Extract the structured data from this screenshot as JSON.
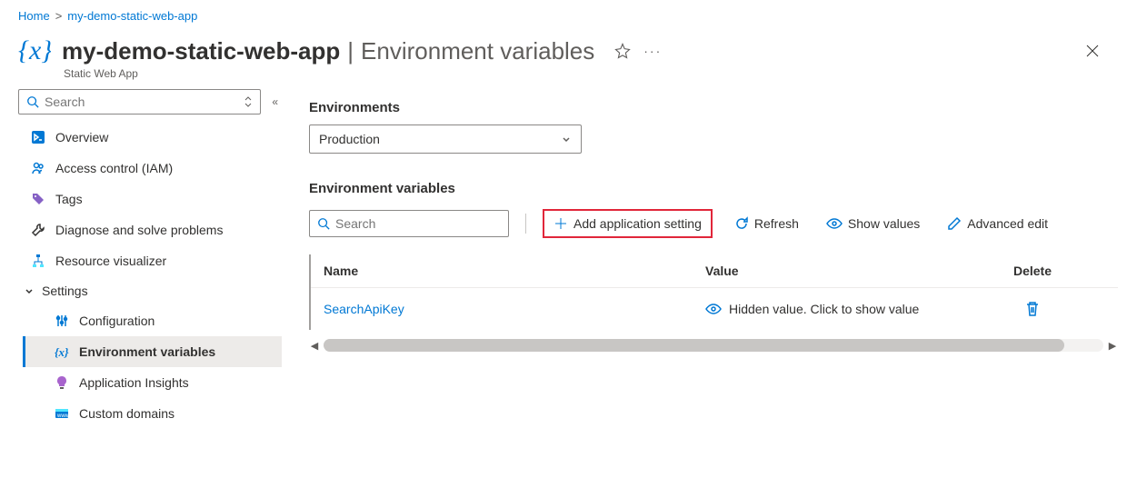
{
  "breadcrumb": {
    "home": "Home",
    "resource": "my-demo-static-web-app"
  },
  "header": {
    "title": "my-demo-static-web-app",
    "section": "Environment variables",
    "resource_type": "Static Web App"
  },
  "sidebar": {
    "search_placeholder": "Search",
    "items": {
      "overview": "Overview",
      "access_control": "Access control (IAM)",
      "tags": "Tags",
      "diagnose": "Diagnose and solve problems",
      "resource_visualizer": "Resource visualizer",
      "settings_header": "Settings",
      "configuration": "Configuration",
      "environment_variables": "Environment variables",
      "application_insights": "Application Insights",
      "custom_domains": "Custom domains"
    }
  },
  "content": {
    "environments_label": "Environments",
    "selected_environment": "Production",
    "env_vars_label": "Environment variables",
    "search_placeholder": "Search",
    "toolbar": {
      "add": "Add application setting",
      "refresh": "Refresh",
      "show_values": "Show values",
      "advanced_edit": "Advanced edit"
    },
    "table": {
      "columns": {
        "name": "Name",
        "value": "Value",
        "delete": "Delete"
      },
      "rows": [
        {
          "name": "SearchApiKey",
          "value_hidden_text": "Hidden value. Click to show value"
        }
      ]
    }
  }
}
